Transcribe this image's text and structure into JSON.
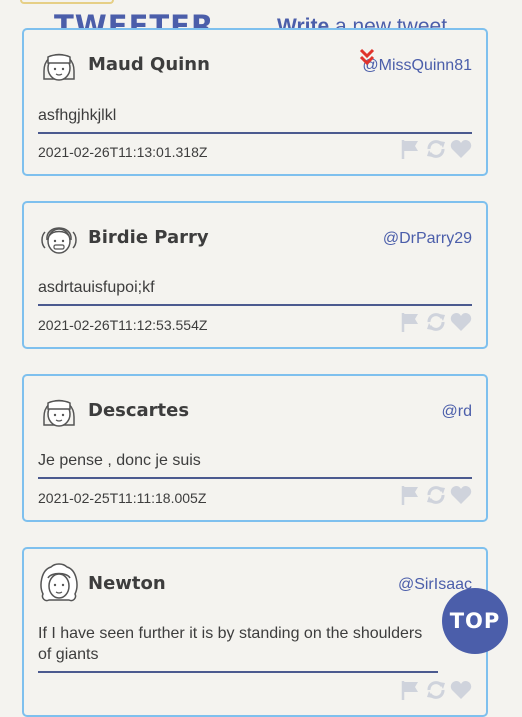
{
  "header": {
    "logo": "TWEETER",
    "write_bold": "Write",
    "write_rest": " a new tweet"
  },
  "tweets": [
    {
      "name": "Maud Quinn",
      "handle": "@MissQuinn81",
      "text": "asfhgjhkjlkl",
      "timestamp": "2021-02-26T11:13:01.318Z",
      "avatar_icon": "girl-avatar-icon"
    },
    {
      "name": "Birdie Parry",
      "handle": "@DrParry29",
      "text": "asdrtauisfupoi;kf",
      "timestamp": "2021-02-26T11:12:53.554Z",
      "avatar_icon": "girl-pigtails-avatar-icon"
    },
    {
      "name": "Descartes",
      "handle": "@rd",
      "text": "Je pense , donc je suis",
      "timestamp": "2021-02-25T11:11:18.005Z",
      "avatar_icon": "girl-avatar-icon"
    },
    {
      "name": "Newton",
      "handle": "@SirIsaac",
      "text": "If I have seen further it is by standing on the shoulders of giants",
      "timestamp": "",
      "avatar_icon": "wig-avatar-icon"
    }
  ],
  "scroll_top": "TOP",
  "colors": {
    "accent": "#4b5eaa",
    "card_border": "#7ec0ee",
    "icon_gray": "#cfd3dc",
    "background": "#f4f3ef",
    "chevron_red": "#e0332b"
  }
}
